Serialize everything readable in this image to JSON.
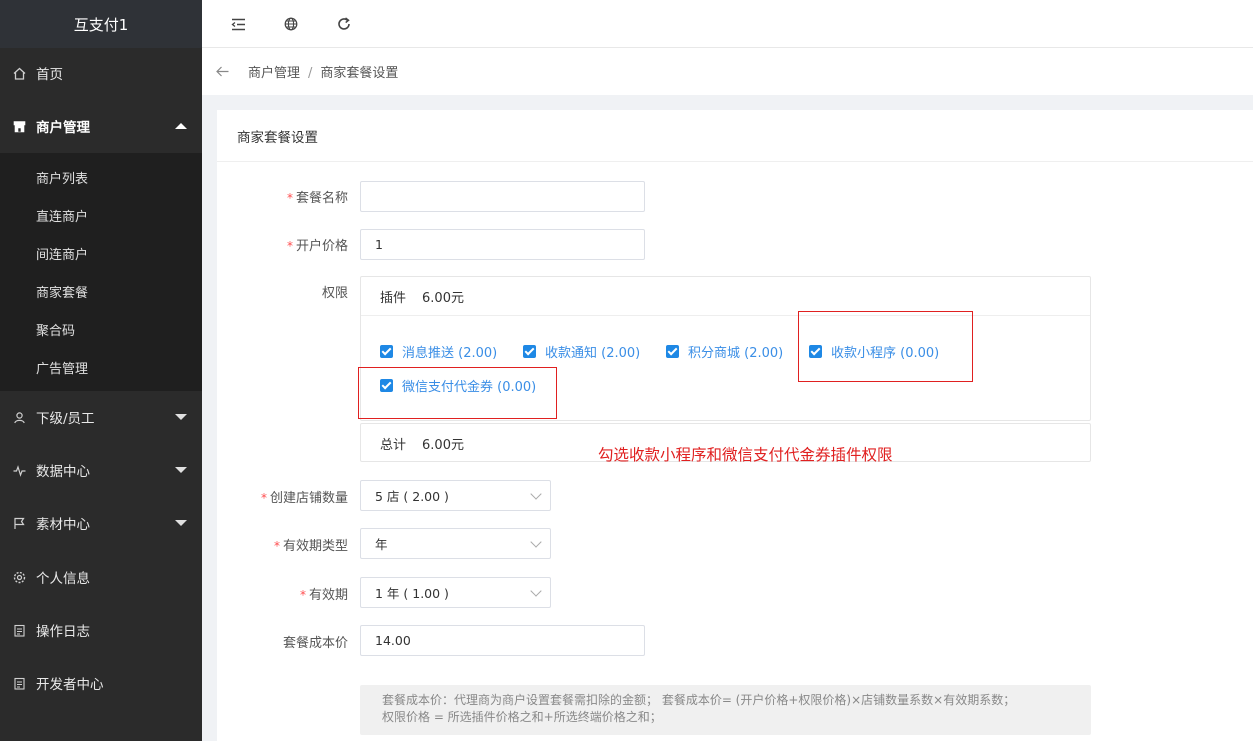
{
  "app": {
    "title": "互支付1"
  },
  "sidebar": {
    "items": [
      {
        "label": "首页",
        "icon": "home-icon"
      },
      {
        "label": "商户管理",
        "icon": "shop-icon"
      },
      {
        "label": "下级/员工",
        "icon": "user-icon"
      },
      {
        "label": "数据中心",
        "icon": "activity-icon"
      },
      {
        "label": "素材中心",
        "icon": "flag-icon"
      },
      {
        "label": "个人信息",
        "icon": "gear-icon"
      },
      {
        "label": "操作日志",
        "icon": "document-icon"
      },
      {
        "label": "开发者中心",
        "icon": "document-icon"
      }
    ],
    "submenu": [
      "商户列表",
      "直连商户",
      "间连商户",
      "商家套餐",
      "聚合码",
      "广告管理"
    ]
  },
  "topbar": {
    "icons": [
      "menu-fold-icon",
      "globe-icon",
      "refresh-icon"
    ]
  },
  "breadcrumb": {
    "parent": "商户管理",
    "separator": "/",
    "current": "商家套餐设置"
  },
  "card": {
    "title": "商家套餐设置"
  },
  "form": {
    "name": {
      "label": "套餐名称",
      "value": ""
    },
    "price": {
      "label": "开户价格",
      "value": "1"
    },
    "permissions": {
      "label": "权限",
      "header_label": "插件",
      "header_value": "6.00元",
      "options": [
        "消息推送 (2.00)",
        "收款通知 (2.00)",
        "积分商城 (2.00)",
        "收款小程序 (0.00)",
        "微信支付代金券 (0.00)"
      ],
      "total_label": "总计",
      "total_value": "6.00元"
    },
    "stores": {
      "label": "创建店铺数量",
      "value": "5 店 ( 2.00 )"
    },
    "validity_type": {
      "label": "有效期类型",
      "value": "年"
    },
    "validity": {
      "label": "有效期",
      "value": "1 年 ( 1.00 )"
    },
    "cost": {
      "label": "套餐成本价",
      "value": "14.00"
    },
    "note_line1": "套餐成本价：代理商为商户设置套餐需扣除的金额； 套餐成本价= (开户价格+权限价格)×店铺数量系数×有效期系数；",
    "note_line2": "权限价格 = 所选插件价格之和+所选终端价格之和；"
  },
  "annotation": "勾选收款小程序和微信支付代金券插件权限",
  "colors": {
    "accent": "#1e88e5",
    "annotation": "#e02020",
    "sidebar": "#2b2b2b"
  }
}
